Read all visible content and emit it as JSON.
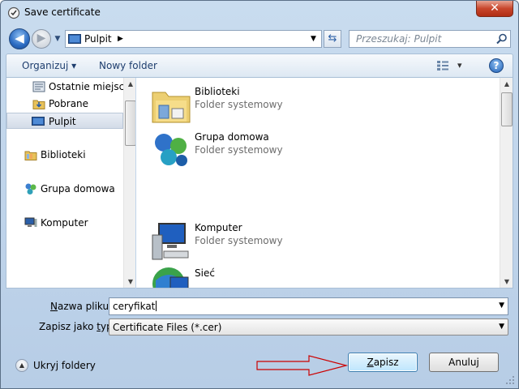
{
  "window": {
    "title": "Save certificate",
    "close_label": "✕"
  },
  "nav": {
    "back_glyph": "◀",
    "forward_glyph": "▶",
    "address": "Pulpit",
    "search_placeholder": "Przeszukaj: Pulpit"
  },
  "toolbar": {
    "organize_label": "Organizuj ▾",
    "new_folder_label": "Nowy folder",
    "view_glyph": "▾",
    "help_glyph": "?"
  },
  "nav_pane": {
    "items": [
      {
        "label": "Ostatnie miejsca",
        "icon": "recent-places-icon"
      },
      {
        "label": "Pobrane",
        "icon": "downloads-folder-icon"
      },
      {
        "label": "Pulpit",
        "icon": "desktop-icon",
        "selected": true
      },
      {
        "label": "Biblioteki",
        "icon": "libraries-icon"
      },
      {
        "label": "Grupa domowa",
        "icon": "homegroup-icon"
      },
      {
        "label": "Komputer",
        "icon": "computer-icon"
      }
    ]
  },
  "content": {
    "items": [
      {
        "name": "Biblioteki",
        "type": "Folder systemowy",
        "icon": "libraries-folder-icon"
      },
      {
        "name": "Grupa domowa",
        "type": "Folder systemowy",
        "icon": "homegroup-icon"
      },
      {
        "name": "Komputer",
        "type": "Folder systemowy",
        "icon": "computer-icon"
      },
      {
        "name": "Sieć",
        "type": "",
        "icon": "network-icon"
      }
    ]
  },
  "form": {
    "filename_label_pre": "",
    "filename_label_u": "N",
    "filename_label_post": "azwa pliku:",
    "filename_value": "ceryfikat",
    "filetype_label_pre": "Zapisz jako ",
    "filetype_label_u": "t",
    "filetype_label_post": "yp:",
    "filetype_value": "Certificate Files (*.cer)"
  },
  "footer": {
    "hide_folders_label": "Ukryj foldery",
    "save_pre": "",
    "save_u": "Z",
    "save_post": "apisz",
    "cancel_label": "Anuluj"
  },
  "colors": {
    "accent": "#3c7fb1",
    "annotation_arrow": "#cc0000"
  }
}
